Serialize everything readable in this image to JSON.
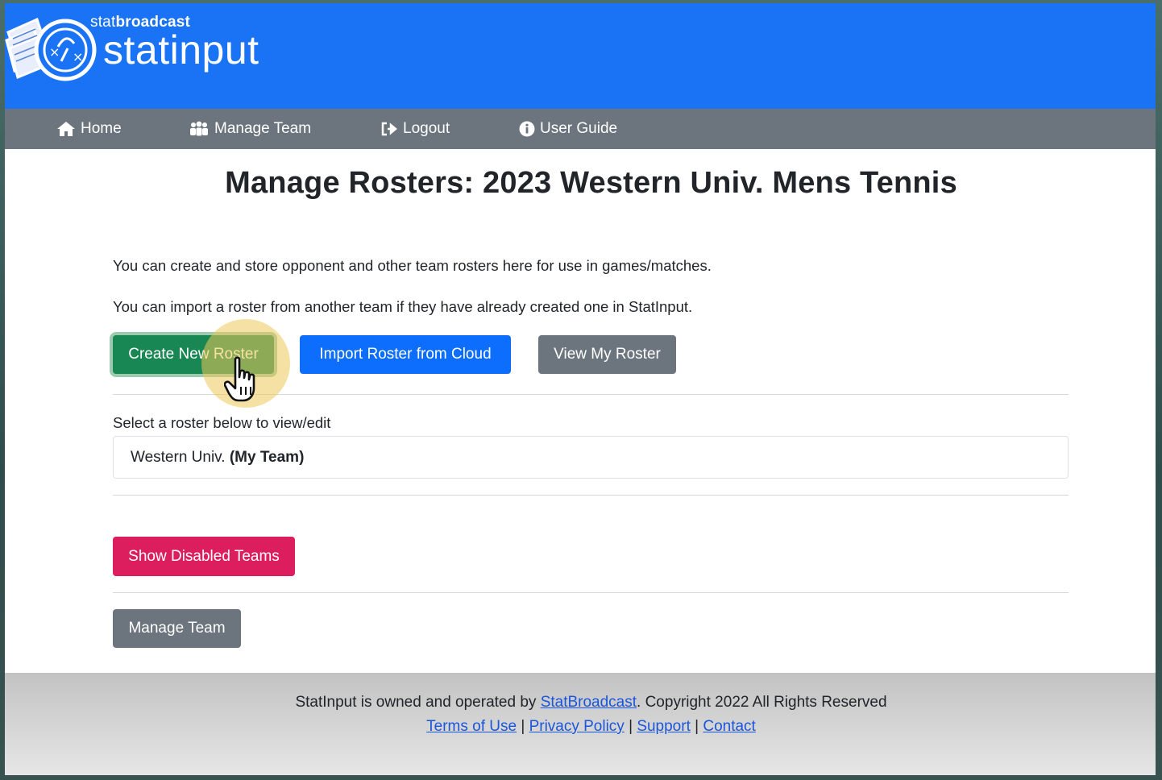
{
  "header": {
    "brand_small_prefix": "stat",
    "brand_small_bold": "broadcast",
    "brand_big": "statinput",
    "brand_color": "#1a73f5"
  },
  "nav": {
    "items": [
      {
        "label": "Home",
        "icon": "home-icon"
      },
      {
        "label": "Manage Team",
        "icon": "users-icon"
      },
      {
        "label": "Logout",
        "icon": "logout-icon"
      },
      {
        "label": "User Guide",
        "icon": "info-icon"
      }
    ]
  },
  "main": {
    "title": "Manage Rosters: 2023 Western Univ. Mens Tennis",
    "paragraph1": "You can create and store opponent and other team rosters here for use in games/matches.",
    "paragraph2": "You can import a roster from another team if they have already created one in StatInput.",
    "buttons": {
      "create": "Create New Roster",
      "import": "Import Roster from Cloud",
      "view": "View My Roster"
    },
    "select_label": "Select a roster below to view/edit",
    "roster_item": {
      "name": "Western Univ.",
      "tag": "(My Team)"
    },
    "show_disabled": "Show Disabled Teams",
    "manage_team": "Manage Team"
  },
  "footer": {
    "prefix": "StatInput is owned and operated by ",
    "owner_link": "StatBroadcast",
    "suffix": ". Copyright 2022 All Rights Reserved",
    "links": [
      "Terms of Use",
      "Privacy Policy",
      "Support",
      "Contact"
    ],
    "separator": "|"
  },
  "colors": {
    "green": "#198754",
    "blue": "#0d6efd",
    "gray": "#6c757d",
    "pink": "#dc1e5f"
  }
}
